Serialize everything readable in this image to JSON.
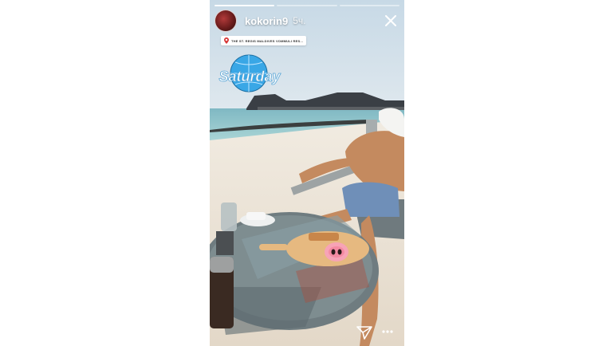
{
  "story": {
    "username": "kokorin9",
    "time_ago": "5ч.",
    "location": "THE ST. REGIS MALDIVES VOMMULI RES...",
    "sticker_text": "Saturday",
    "progress": {
      "total": 3,
      "current": 1
    },
    "icons": {
      "close": "close-icon",
      "location": "location-pin-icon",
      "send": "send-icon",
      "more": "more-icon",
      "sticker": "disco-ball-sticker",
      "pig": "pig-nose-sticker"
    }
  }
}
